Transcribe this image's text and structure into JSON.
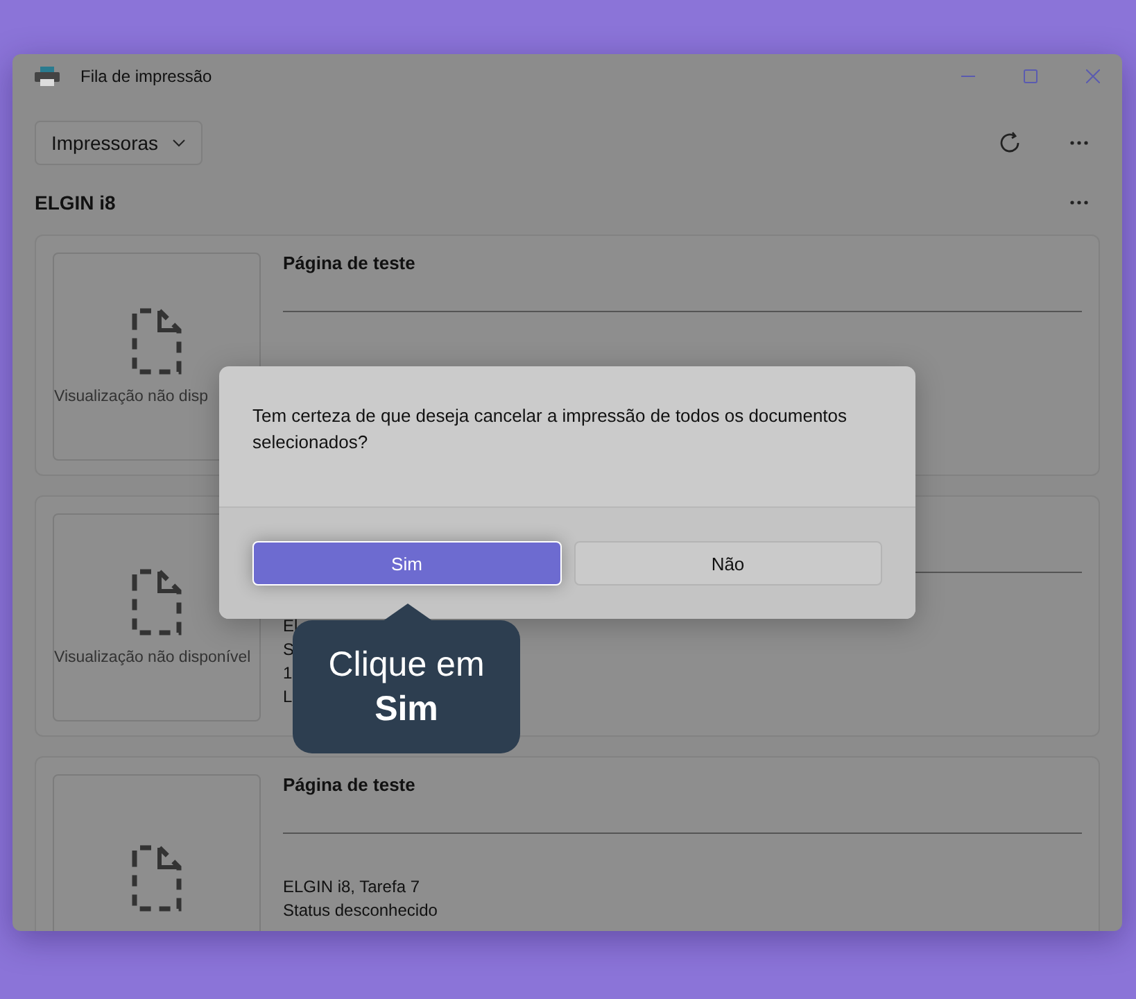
{
  "window": {
    "title": "Fila de impressão"
  },
  "toolbar": {
    "dropdown": "Impressoras"
  },
  "printer": {
    "name": "ELGIN i8"
  },
  "jobs": [
    {
      "preview": "Visualização não disp",
      "title": "Página de teste"
    },
    {
      "preview": "Visualização não disponível",
      "lines": [
        "El",
        "S",
        "1",
        "L"
      ]
    },
    {
      "title": "Página de teste",
      "lines": [
        "ELGIN i8, Tarefa 7",
        "Status desconhecido"
      ]
    }
  ],
  "dialog": {
    "message": "Tem certeza de que deseja cancelar a impressão de todos os documentos selecionados?",
    "buttons": [
      {
        "label": "Sim",
        "selected": true
      },
      {
        "label": "Não",
        "selected": false
      }
    ]
  },
  "tooltip": {
    "text": "Clique em",
    "emphasis": "Sim"
  }
}
